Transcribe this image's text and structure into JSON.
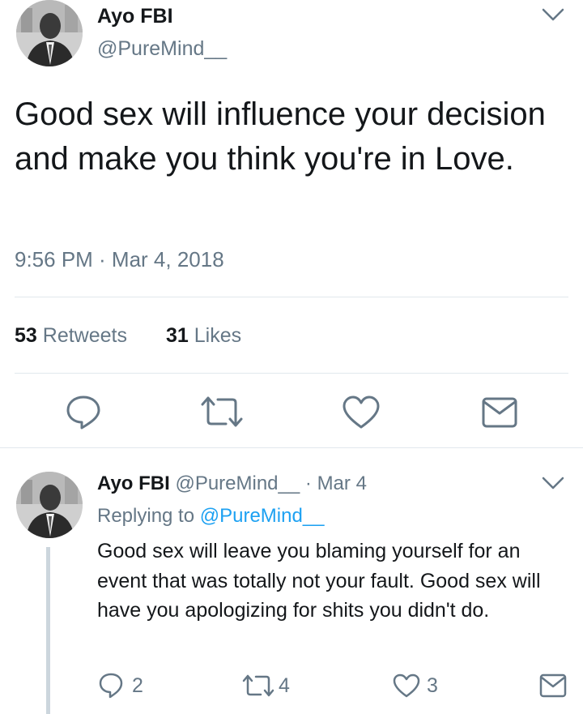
{
  "tweet": {
    "author_name": "Ayo FBI",
    "author_handle": "@PureMind__",
    "text": "Good sex will influence your decision and make you think you're in Love.",
    "timestamp": "9:56 PM · Mar 4, 2018",
    "retweets_count": "53",
    "retweets_label": "Retweets",
    "likes_count": "31",
    "likes_label": "Likes",
    "actions": [
      "reply-icon",
      "retweet-icon",
      "like-icon",
      "dm-icon"
    ]
  },
  "reply": {
    "author_name": "Ayo FBI",
    "author_handle": "@PureMind__",
    "date": "· Mar 4",
    "replying_prefix": "Replying to",
    "replying_handle": "@PureMind__",
    "text": "Good sex will leave you blaming yourself for an event that was totally not your fault. Good sex will have you apologizing for shits you didn't do.",
    "reply_count": "2",
    "retweet_count": "4",
    "like_count": "3"
  },
  "colors": {
    "text": "#14171a",
    "secondary": "#657786",
    "link": "#1da1f2",
    "divider": "#e1e8ed"
  }
}
